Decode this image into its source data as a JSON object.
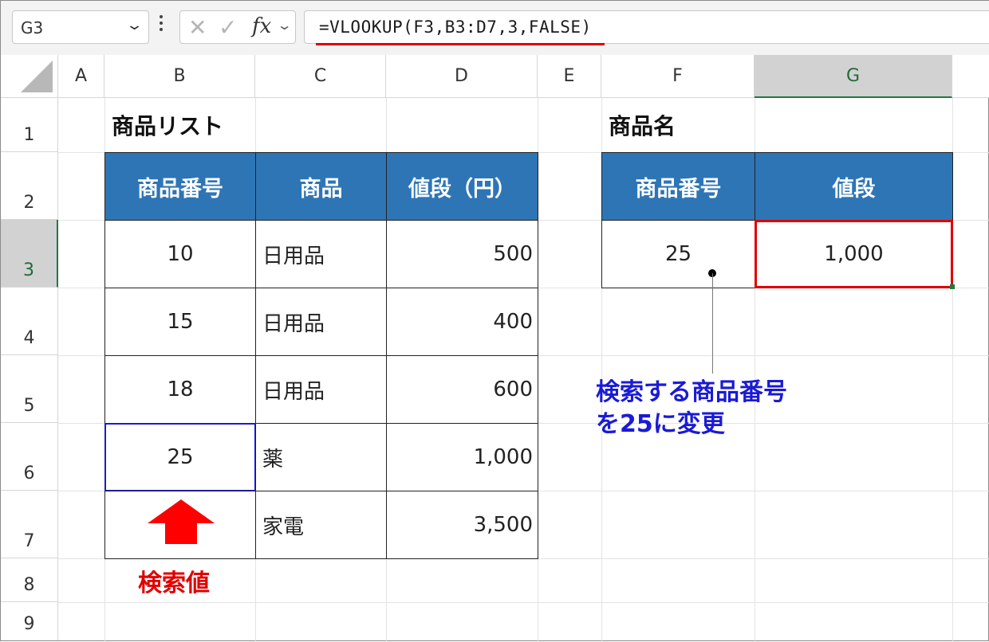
{
  "namebox": {
    "value": "G3"
  },
  "formula_bar": {
    "fx_label": "fx",
    "formula": "=VLOOKUP(F3,B3:D7,3,FALSE)"
  },
  "columns": [
    "A",
    "B",
    "C",
    "D",
    "E",
    "F",
    "G"
  ],
  "selected_column": "G",
  "rows": [
    "1",
    "2",
    "3",
    "4",
    "5",
    "6",
    "7",
    "8",
    "9"
  ],
  "selected_row": "3",
  "product_list": {
    "title": "商品リスト",
    "headers": [
      "商品番号",
      "商品",
      "値段（円）"
    ],
    "rows": [
      [
        "10",
        "日用品",
        "500"
      ],
      [
        "15",
        "日用品",
        "400"
      ],
      [
        "18",
        "日用品",
        "600"
      ],
      [
        "25",
        "薬",
        "1,000"
      ],
      [
        "",
        "家電",
        "3,500"
      ]
    ]
  },
  "lookup": {
    "title": "商品名",
    "headers": [
      "商品番号",
      "値段"
    ],
    "id": "25",
    "result": "1,000"
  },
  "annotations": {
    "blue_line1": "検索する商品番号",
    "blue_line2": "を25に変更",
    "red": "検索値"
  },
  "colors": {
    "header_blue": "#2e75b6",
    "highlight_red": "#e00000",
    "highlight_blue": "#1a1ad6"
  }
}
